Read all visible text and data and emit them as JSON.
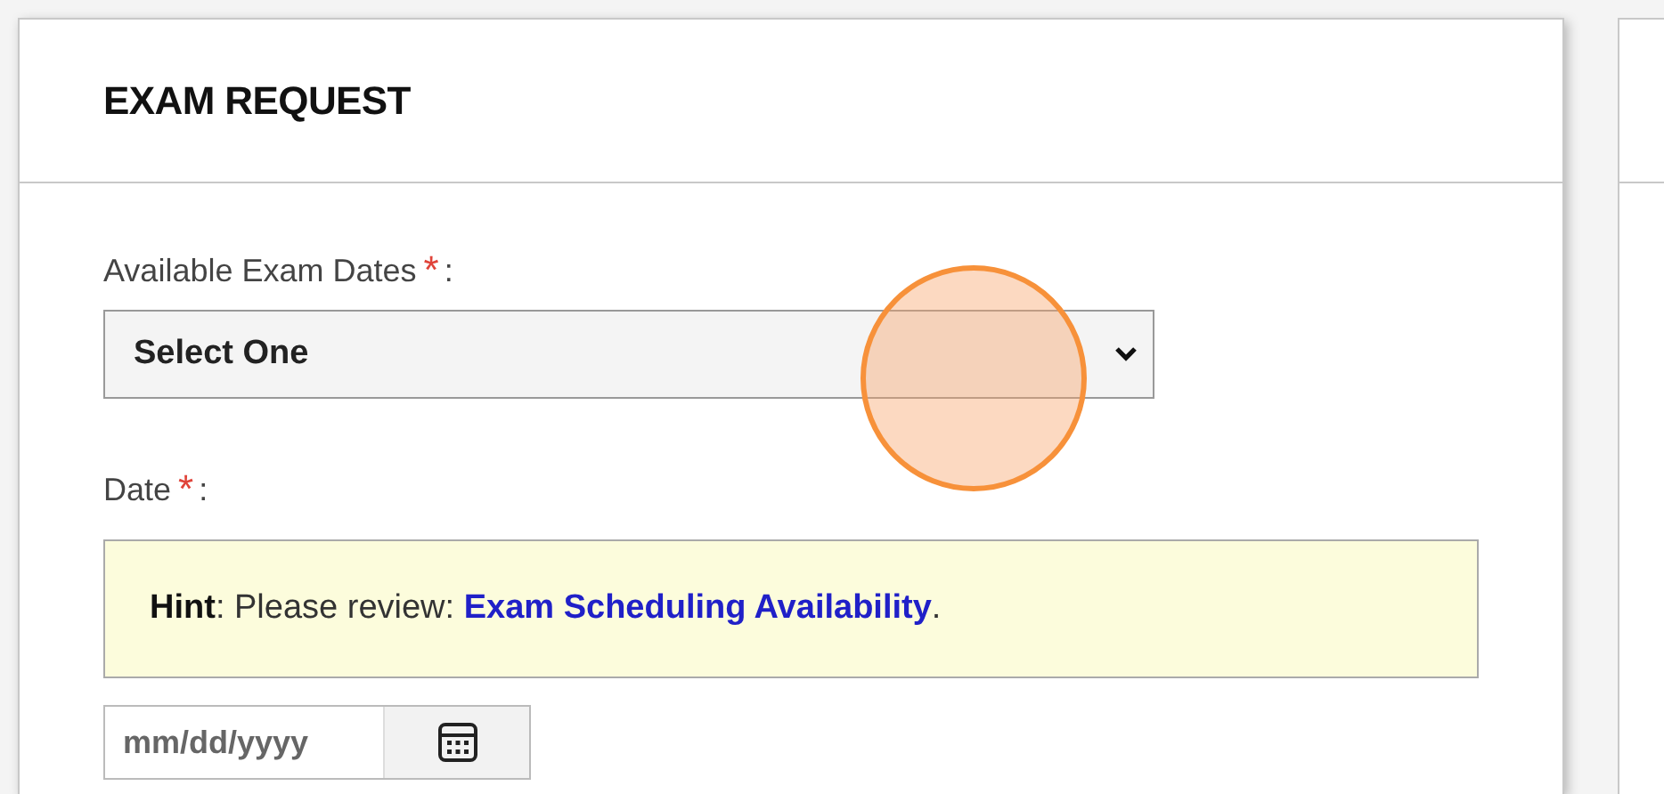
{
  "card": {
    "title": "EXAM REQUEST"
  },
  "exam_dates": {
    "label": "Available Exam Dates",
    "required_mark": "*",
    "suffix": ":",
    "value": "Select One"
  },
  "date": {
    "label": "Date",
    "required_mark": "*",
    "suffix": ":",
    "placeholder": "mm/dd/yyyy"
  },
  "hint": {
    "text": "**Hint**: Please review: ",
    "link": "Exam Scheduling Availability",
    "after": "."
  },
  "click_indicator": {
    "shown": true
  }
}
